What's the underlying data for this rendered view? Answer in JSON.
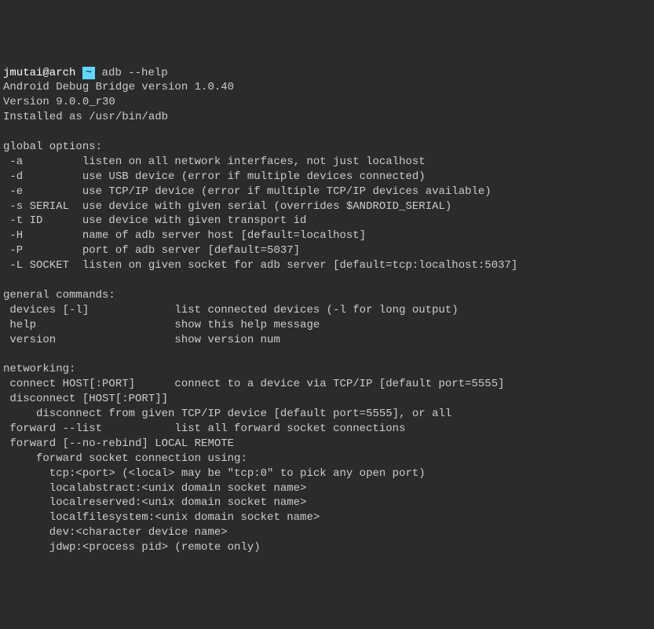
{
  "prompt": {
    "user": "jmutai@arch",
    "arrow_left": "",
    "tilde": "~",
    "arrow_right": "",
    "command": "adb --help"
  },
  "output": {
    "lines": [
      "Android Debug Bridge version 1.0.40",
      "Version 9.0.0_r30",
      "Installed as /usr/bin/adb",
      "",
      "global options:",
      " -a         listen on all network interfaces, not just localhost",
      " -d         use USB device (error if multiple devices connected)",
      " -e         use TCP/IP device (error if multiple TCP/IP devices available)",
      " -s SERIAL  use device with given serial (overrides $ANDROID_SERIAL)",
      " -t ID      use device with given transport id",
      " -H         name of adb server host [default=localhost]",
      " -P         port of adb server [default=5037]",
      " -L SOCKET  listen on given socket for adb server [default=tcp:localhost:5037]",
      "",
      "general commands:",
      " devices [-l]             list connected devices (-l for long output)",
      " help                     show this help message",
      " version                  show version num",
      "",
      "networking:",
      " connect HOST[:PORT]      connect to a device via TCP/IP [default port=5555]",
      " disconnect [HOST[:PORT]]",
      "     disconnect from given TCP/IP device [default port=5555], or all",
      " forward --list           list all forward socket connections",
      " forward [--no-rebind] LOCAL REMOTE",
      "     forward socket connection using:",
      "       tcp:<port> (<local> may be \"tcp:0\" to pick any open port)",
      "       localabstract:<unix domain socket name>",
      "       localreserved:<unix domain socket name>",
      "       localfilesystem:<unix domain socket name>",
      "       dev:<character device name>",
      "       jdwp:<process pid> (remote only)"
    ]
  }
}
